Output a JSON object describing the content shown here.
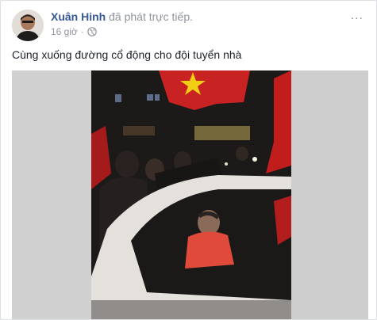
{
  "post": {
    "author": "Xuân Hinh",
    "action": " đã phát trực tiếp.",
    "time": "16 giờ",
    "separator": "·",
    "text": "Cùng xuống đường cổ động cho đội tuyển nhà",
    "privacy_icon": "globe-icon",
    "more_icon": "more-options-icon",
    "more_label": "..."
  },
  "video": {
    "type": "live-video-frame",
    "colors": {
      "flag_red": "#d21f1f",
      "flag_star": "#f5d000",
      "night": "#1c1a19",
      "side_blur": "#d8d8d8"
    }
  }
}
